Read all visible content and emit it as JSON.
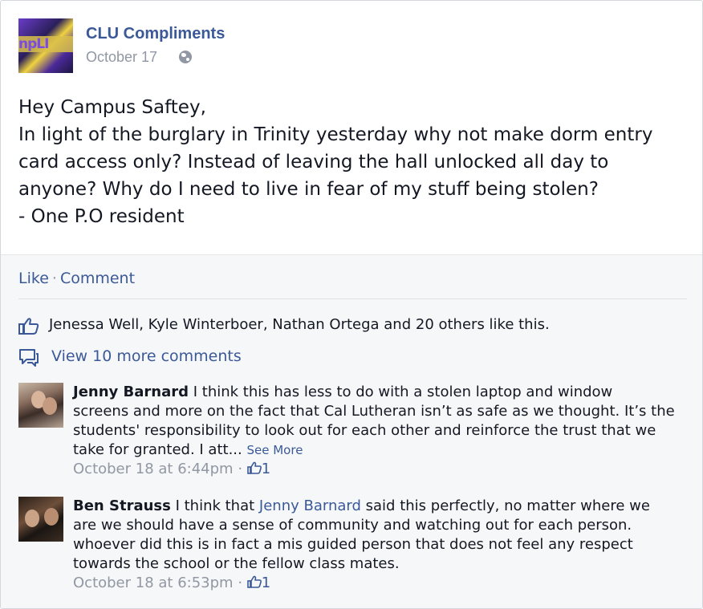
{
  "post": {
    "page_name": "CLU Compliments",
    "date": "October 17",
    "avatar_text": "npLI",
    "body_lines": [
      "Hey Campus Saftey,",
      "In light of the burglary in Trinity yesterday why not make dorm entry",
      "card access only? Instead of leaving the hall unlocked all day to",
      "anyone? Why do I need to live in fear of my stuff being stolen?",
      "- One P.O resident"
    ]
  },
  "actions": {
    "like": "Like",
    "separator": "·",
    "comment": "Comment"
  },
  "likes": {
    "text": "Jenessa Well, Kyle Winterboer, Nathan Ortega and 20 others like this."
  },
  "more_comments": {
    "text": "View 10 more comments"
  },
  "comments": [
    {
      "author": "Jenny Barnard",
      "line1": "I think this has less to do with a stolen laptop and window",
      "line2": "screens and more on the fact that Cal Lutheran isn’t as safe as we thought. It’s the",
      "line3": "students' responsibility to look out for each other and reinforce the trust that we",
      "line4": "take for granted. I att...",
      "see_more": "See More",
      "timestamp": "October 18 at 6:44pm",
      "separator": "·",
      "like_count": "1"
    },
    {
      "author": "Ben Strauss",
      "line1_pre": "I think that",
      "mention": "Jenny Barnard",
      "line1_post": "said this perfectly, no matter where we",
      "line2": "are we should have a sense of community and watching out for each person.",
      "line3": "whoever did this is in fact a mis guided person that does not feel any respect",
      "line4": "towards the school or the fellow class mates.",
      "timestamp": "October 18 at 6:53pm",
      "separator": "·",
      "like_count": "1"
    }
  ],
  "colors": {
    "link": "#3b5998",
    "meta": "#9197a3",
    "text": "#141823",
    "footer_bg": "#f6f7f8"
  }
}
